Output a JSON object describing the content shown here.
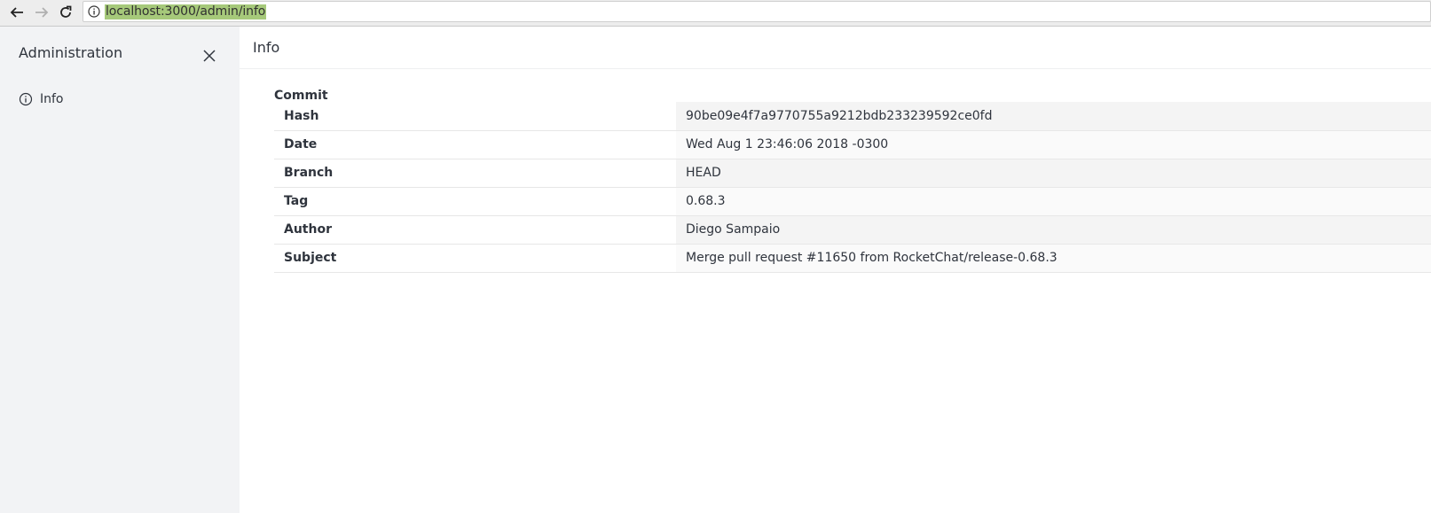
{
  "browser": {
    "url": "localhost:3000/admin/info"
  },
  "sidebar": {
    "title": "Administration",
    "items": [
      {
        "label": "Info",
        "icon": "info-circle-icon"
      }
    ]
  },
  "main": {
    "title": "Info",
    "section": "Commit",
    "rows": [
      {
        "key": "Hash",
        "value": "90be09e4f7a9770755a9212bdb233239592ce0fd"
      },
      {
        "key": "Date",
        "value": "Wed Aug 1 23:46:06 2018 -0300"
      },
      {
        "key": "Branch",
        "value": "HEAD"
      },
      {
        "key": "Tag",
        "value": "0.68.3"
      },
      {
        "key": "Author",
        "value": "Diego Sampaio"
      },
      {
        "key": "Subject",
        "value": "Merge pull request #11650 from RocketChat/release-0.68.3"
      }
    ]
  },
  "colors": {
    "sidebar_bg": "#f2f3f5",
    "url_selection": "#a6c97a",
    "text": "#2f343d"
  }
}
